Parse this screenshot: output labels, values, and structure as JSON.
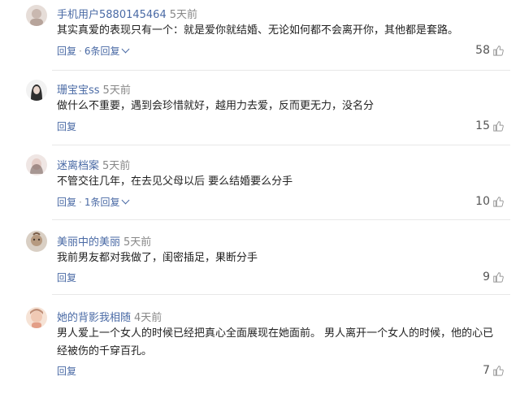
{
  "comments": [
    {
      "username": "手机用户5880145464",
      "time": "5天前",
      "content": "其实真爱的表现只有一个：就是爱你就结婚、无论如何都不会离开你，其他都是套路。",
      "reply_label": "回复",
      "reply_count": "6条回复",
      "likes": "58",
      "avatar_color": "#c9b8b0"
    },
    {
      "username": "珊宝宝ss",
      "time": "5天前",
      "content": "做什么不重要，遇到会珍惜就好，越用力去爱，反而更无力，没名分",
      "reply_label": "回复",
      "likes": "15",
      "avatar_color": "#3a3a3a"
    },
    {
      "username": "迷离档案",
      "time": "5天前",
      "content": "不管交往几年，在去见父母以后 要么结婚要么分手",
      "reply_label": "回复",
      "reply_count": "1条回复",
      "likes": "10",
      "avatar_color": "#d8c4c0"
    },
    {
      "username": "美丽中的美丽",
      "time": "5天前",
      "content": "我前男友都对我做了，闺密插足，果断分手",
      "reply_label": "回复",
      "likes": "9",
      "avatar_color": "#a88f78"
    },
    {
      "username": "她的背影我相随",
      "time": "4天前",
      "content": "男人爱上一个女人的时候已经把真心全面展现在她面前。 男人离开一个女人的时候，他的心已经被伤的千穿百孔。",
      "reply_label": "回复",
      "likes": "7",
      "avatar_color": "#e9b9a5"
    }
  ]
}
